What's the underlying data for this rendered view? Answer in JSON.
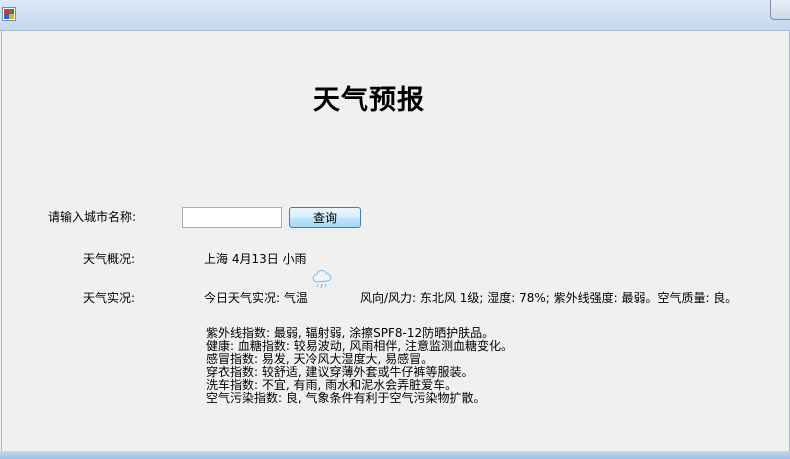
{
  "header": {
    "title": "天气预报"
  },
  "form": {
    "city_label": "请输入城市名称:",
    "city_value": "",
    "query_label": "查询"
  },
  "overview": {
    "label": "天气概况:",
    "value": "上海 4月13日 小雨"
  },
  "current": {
    "label": "天气实况:",
    "today": "今日天气实况: 气温",
    "wind": "风向/风力: 东北风 1级; 湿度: 78%; 紫外线强度: 最弱。空气质量: 良。",
    "icon": "cloud-rain-icon"
  },
  "indices": [
    "紫外线指数: 最弱, 辐射弱, 涂擦SPF8-12防晒护肤品。",
    "健康: 血糖指数: 较易波动, 风雨相伴, 注意监测血糖变化。",
    "感冒指数: 易发, 天冷风大湿度大, 易感冒。",
    "穿衣指数: 较舒适, 建议穿薄外套或牛仔裤等服装。",
    "洗车指数: 不宜, 有雨, 雨水和泥水会弄脏爱车。",
    "空气污染指数: 良, 气象条件有利于空气污染物扩散。"
  ]
}
